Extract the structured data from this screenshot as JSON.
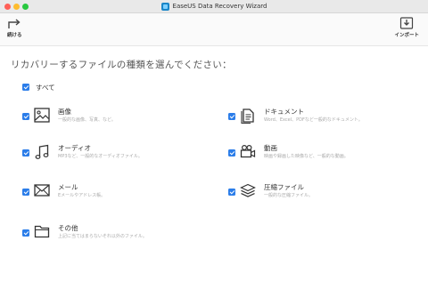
{
  "window": {
    "title": "EaseUS Data Recovery Wizard"
  },
  "toolbar": {
    "continue_label": "続ける",
    "import_label": "インポート"
  },
  "heading": "リカバリーするファイルの種類を選んでください：",
  "select_all": {
    "label": "すべて",
    "checked": true
  },
  "categories": [
    {
      "label": "画像",
      "desc": "一般的な画像、写真、など。",
      "checked": true,
      "icon": "image-icon"
    },
    {
      "label": "ドキュメント",
      "desc": "Word、Excel、PDFなど一般的なドキュメント。",
      "checked": true,
      "icon": "document-icon"
    },
    {
      "label": "オーディオ",
      "desc": "MP3など、一般的なオーディオファイル。",
      "checked": true,
      "icon": "music-note-icon"
    },
    {
      "label": "動画",
      "desc": "映画や録画した映像など、一般的な動画。",
      "checked": true,
      "icon": "video-camera-icon"
    },
    {
      "label": "メール",
      "desc": "Eメールやアドレス帳。",
      "checked": true,
      "icon": "envelope-icon"
    },
    {
      "label": "圧縮ファイル",
      "desc": "一般的な圧縮ファイル。",
      "checked": true,
      "icon": "layers-icon"
    },
    {
      "label": "その他",
      "desc": "上記に当てはまらないそれ以外のファイル。",
      "checked": true,
      "icon": "folder-icon"
    }
  ],
  "colors": {
    "accent": "#2b7de9",
    "titlebar": "#e9e9e9"
  }
}
